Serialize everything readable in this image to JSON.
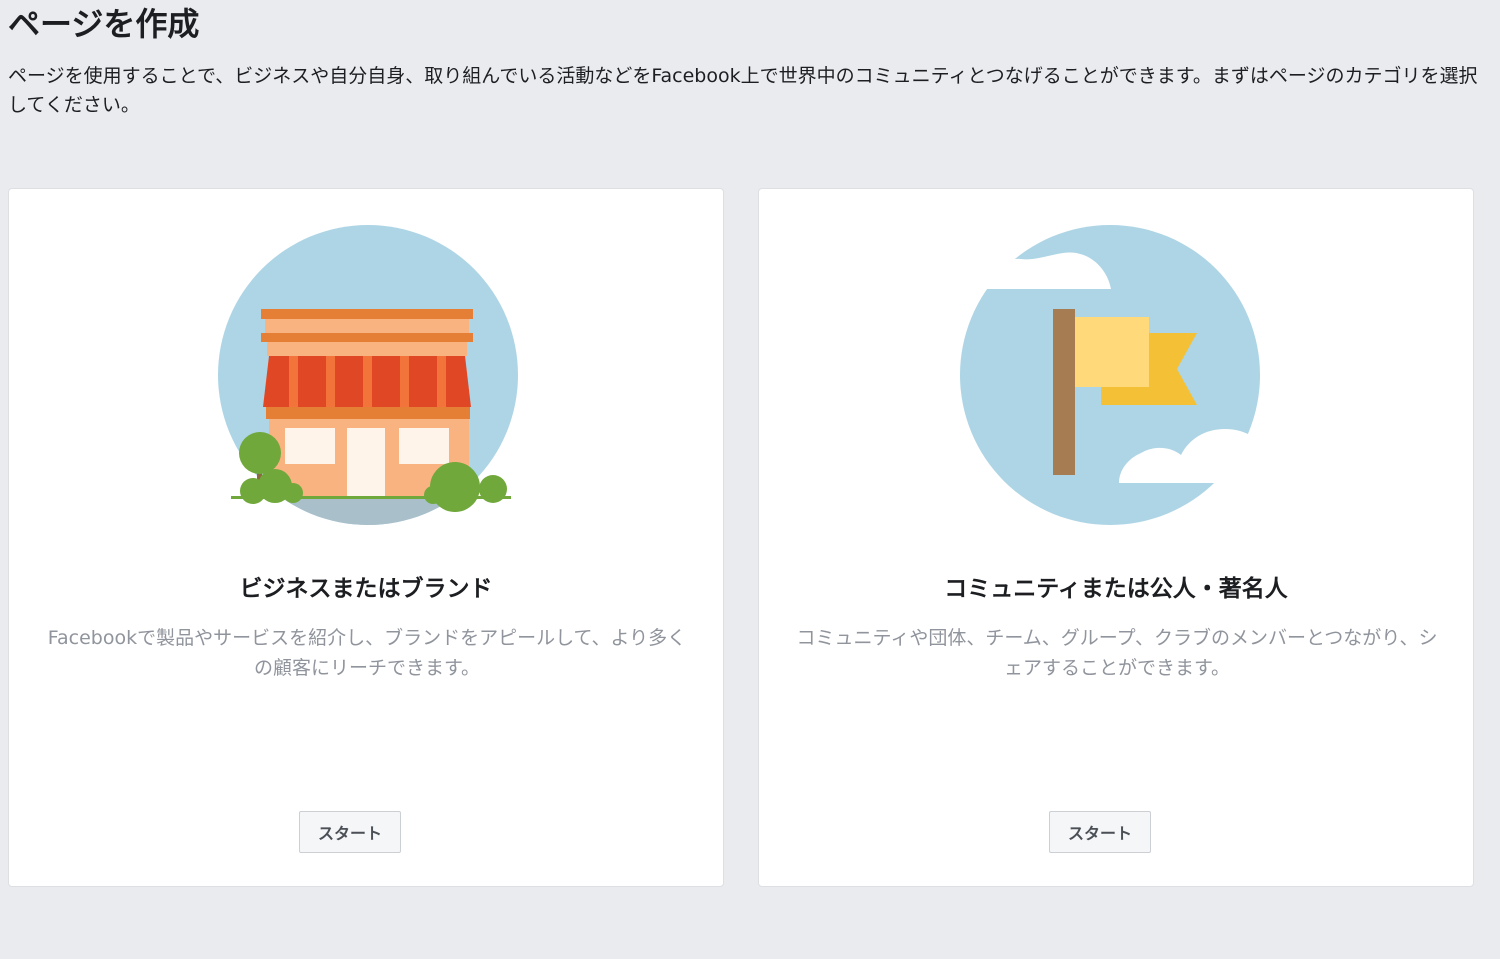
{
  "header": {
    "title": "ページを作成",
    "description": "ページを使用することで、ビジネスや自分自身、取り組んでいる活動などをFacebook上で世界中のコミュニティとつなげることができます。まずはページのカテゴリを選択してください。"
  },
  "cards": [
    {
      "illustration": "storefront-icon",
      "title": "ビジネスまたはブランド",
      "description": "Facebookで製品やサービスを紹介し、ブランドをアピールして、より多くの顧客にリーチできます。",
      "button_label": "スタート"
    },
    {
      "illustration": "flag-icon",
      "title": "コミュニティまたは公人・著名人",
      "description": "コミュニティや団体、チーム、グループ、クラブのメンバーとつながり、シェアすることができます。",
      "button_label": "スタート"
    }
  ],
  "colors": {
    "page_background": "#e9ebee",
    "card_background": "#ffffff",
    "illustration_sky": "#aed5e5",
    "awning_red": "#e04825",
    "store_orange": "#f9b380",
    "flag_yellow": "#ffd97a",
    "tree_green": "#70a83b"
  }
}
